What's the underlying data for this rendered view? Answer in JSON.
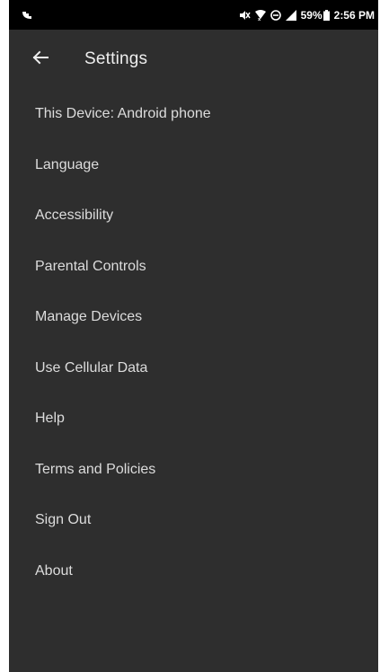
{
  "status_bar": {
    "battery_percent": "59%",
    "time": "2:56 PM",
    "icons": [
      "vpn-key-icon",
      "mute-icon",
      "wifi-icon",
      "data-saver-icon",
      "signal-icon",
      "battery-icon"
    ]
  },
  "header": {
    "title": "Settings",
    "back_icon": "arrow-left-icon"
  },
  "menu": {
    "items": [
      {
        "label": "This Device: Android phone"
      },
      {
        "label": "Language"
      },
      {
        "label": "Accessibility"
      },
      {
        "label": "Parental Controls"
      },
      {
        "label": "Manage Devices"
      },
      {
        "label": "Use Cellular Data"
      },
      {
        "label": "Help"
      },
      {
        "label": "Terms and Policies"
      },
      {
        "label": "Sign Out"
      },
      {
        "label": "About"
      }
    ]
  },
  "colors": {
    "background": "#2e2e2e",
    "status_bar": "#000000",
    "text": "#dcdcdc"
  }
}
